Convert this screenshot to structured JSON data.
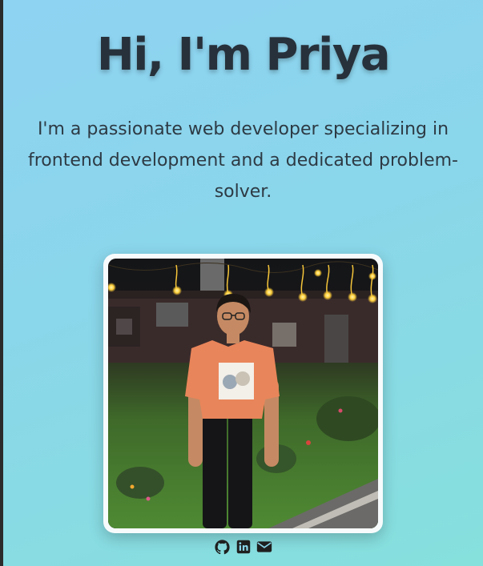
{
  "hero": {
    "heading": "Hi, I'm Priya",
    "intro": "I'm a passionate web developer specializing in frontend development and a dedicated problem-solver."
  },
  "photo": {
    "subject": "portrait photo of Priya"
  },
  "social_links": [
    {
      "icon": "github-icon"
    },
    {
      "icon": "linkedin-icon"
    },
    {
      "icon": "email-icon"
    }
  ],
  "colors": {
    "background_start": "#8fd3f2",
    "background_end": "#86e0dc",
    "text": "#27313b",
    "icon": "#1f1f1f"
  }
}
